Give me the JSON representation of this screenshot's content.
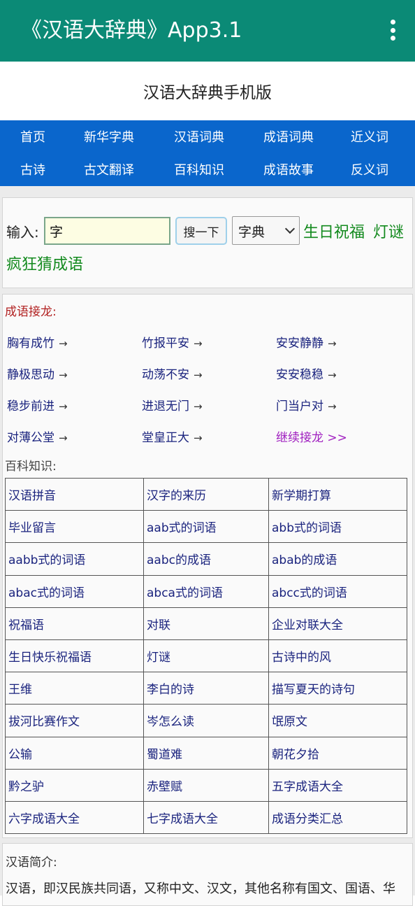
{
  "app_bar": {
    "title": "《汉语大辞典》App3.1",
    "menu_icon": "more-vert-icon"
  },
  "site_title": "汉语大辞典手机版",
  "nav": {
    "row1": [
      "首页",
      "新华字典",
      "汉语词典",
      "成语词典",
      "近义词"
    ],
    "row2": [
      "古诗",
      "古文翻译",
      "百科知识",
      "成语故事",
      "反义词"
    ]
  },
  "search": {
    "label": "输入:",
    "input_value": "字",
    "button_label": "搜一下",
    "select_value": "字典",
    "links": [
      "生日祝福",
      "灯谜",
      "疯狂猜成语"
    ]
  },
  "idiom_chain": {
    "title": "成语接龙:",
    "items": [
      "胸有成竹",
      "竹报平安",
      "安安静静",
      "静极思动",
      "动荡不安",
      "安安稳稳",
      "稳步前进",
      "进退无门",
      "门当户对",
      "对薄公堂",
      "堂皇正大"
    ],
    "arrow": "→",
    "more": "继续接龙 >>"
  },
  "knowledge": {
    "title": "百科知识:",
    "rows": [
      [
        "汉语拼音",
        "汉字的来历",
        "新学期打算"
      ],
      [
        "毕业留言",
        "aab式的词语",
        "abb式的词语"
      ],
      [
        "aabb式的词语",
        "aabc的成语",
        "abab的成语"
      ],
      [
        "abac式的词语",
        "abca式的词语",
        "abcc式的词语"
      ],
      [
        "祝福语",
        "对联",
        "企业对联大全"
      ],
      [
        "生日快乐祝福语",
        "灯谜",
        "古诗中的风"
      ],
      [
        "王维",
        "李白的诗",
        "描写夏天的诗句"
      ],
      [
        "拔河比赛作文",
        "岑怎么读",
        "氓原文"
      ],
      [
        "公输",
        "蜀道难",
        "朝花夕拾"
      ],
      [
        "黔之驴",
        "赤壁赋",
        "五字成语大全"
      ],
      [
        "六字成语大全",
        "七字成语大全",
        "成语分类汇总"
      ]
    ]
  },
  "intro": {
    "title": "汉语简介:",
    "text": "汉语，即汉民族共同语，又称中文、汉文，其他名称有国文、国语、华"
  },
  "colors": {
    "app_bar": "#0b8a76",
    "nav": "#0a66cc",
    "link_green": "#138a1e",
    "link_navy": "#1a237e",
    "section_red": "#b22222",
    "more_purple": "#a020c0"
  }
}
